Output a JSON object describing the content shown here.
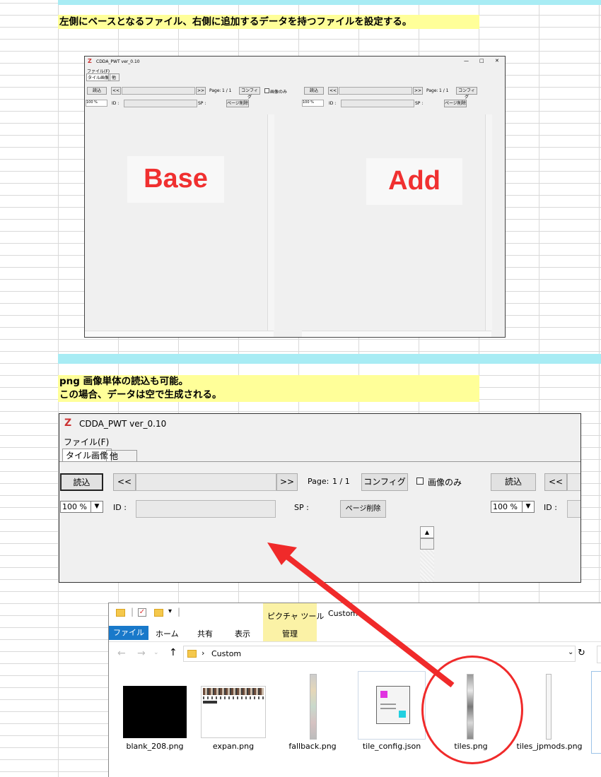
{
  "notes": {
    "note1": "左側にベースとなるファイル、右側に追加するデータを持つファイルを設定する。",
    "note2_line1": "png 画像単体の読込も可能。",
    "note2_line2": "この場合、データは空で生成される。"
  },
  "app": {
    "title": "CDDA_PWT ver_0.10",
    "menu_file": "ファイル(F)",
    "tab_tiles": "タイル画像",
    "tab_other": "他",
    "load_label": "読込",
    "prev_label": "<<",
    "next_label": ">>",
    "page_label": "Page:",
    "page_value": "1 / 1",
    "config_label": "コンフィグ",
    "image_only_label": "画像のみ",
    "zoom_value": "100 %",
    "id_label": "ID :",
    "sp_label": "SP :",
    "delete_page_label": "ページ削除",
    "base_label": "Base",
    "add_label": "Add",
    "window_min": "—",
    "window_max": "□",
    "window_close": "✕"
  },
  "explorer": {
    "picture_tools": "ピクチャ ツール",
    "title": "Custom",
    "tabs": [
      "ファイル",
      "ホーム",
      "共有",
      "表示"
    ],
    "manage_tab": "管理",
    "address": "Custom",
    "files": [
      {
        "name": "blank_208.png"
      },
      {
        "name": "expan.png"
      },
      {
        "name": "fallback.png"
      },
      {
        "name": "tile_config.json"
      },
      {
        "name": "tiles.png"
      },
      {
        "name": "tiles_jpmods.png"
      }
    ]
  },
  "colors": {
    "highlight_yellow": "#ffff99",
    "cyan": "#a8ecf4",
    "annotation_red": "#f02a2a",
    "explorer_blue": "#1979ca"
  }
}
